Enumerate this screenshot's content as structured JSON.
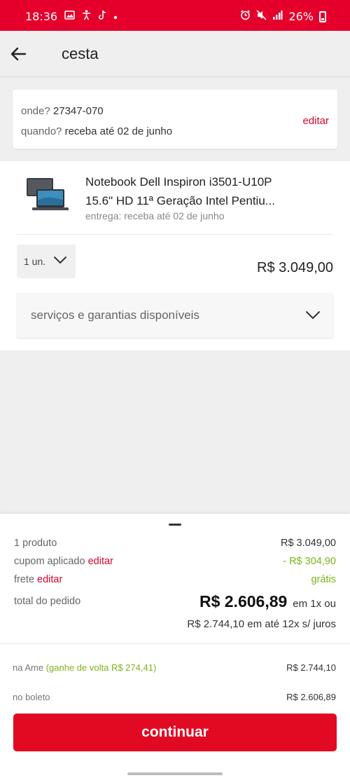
{
  "status_bar": {
    "time": "18:36",
    "battery": "26%",
    "icons_left": [
      "gallery-icon",
      "accessibility-icon",
      "tiktok-icon",
      "dot-icon"
    ],
    "icons_right": [
      "alarm-icon",
      "mute-icon",
      "signal-icon",
      "battery-icon"
    ]
  },
  "header": {
    "title": "cesta"
  },
  "location": {
    "where_label": "onde?",
    "where_value": "27347-070",
    "when_label": "quando?",
    "when_value": "receba até 02 de junho",
    "edit_label": "editar"
  },
  "item": {
    "name_line1": "Notebook Dell Inspiron i3501-U10P",
    "name_line2": "15.6\" HD 11ª Geração Intel Pentiu...",
    "delivery": "entrega: receba até 02 de junho",
    "quantity": "1 un.",
    "price": "R$ 3.049,00",
    "services_label": "serviços e garantias disponíveis"
  },
  "summary": {
    "products_label": "1 produto",
    "products_value": "R$ 3.049,00",
    "coupon_label": "cupom aplicado",
    "coupon_edit": "editar",
    "coupon_value": "- R$ 304,90",
    "shipping_label": "frete",
    "shipping_edit": "editar",
    "shipping_value": "grátis",
    "total_label": "total do pedido",
    "total_value": "R$ 2.606,89",
    "total_condition": "em 1x ou",
    "installments": "R$ 2.744,10 em até 12x s/ juros",
    "ame_label": "na Ame",
    "ame_cashback": "(ganhe de volta R$ 274,41)",
    "ame_value": "R$ 2.744,10",
    "boleto_label": "no boleto",
    "boleto_value": "R$ 2.606,89"
  },
  "cta": {
    "label": "continuar"
  },
  "colors": {
    "brand_red": "#e4002b",
    "cashback_green": "#7cb518"
  }
}
